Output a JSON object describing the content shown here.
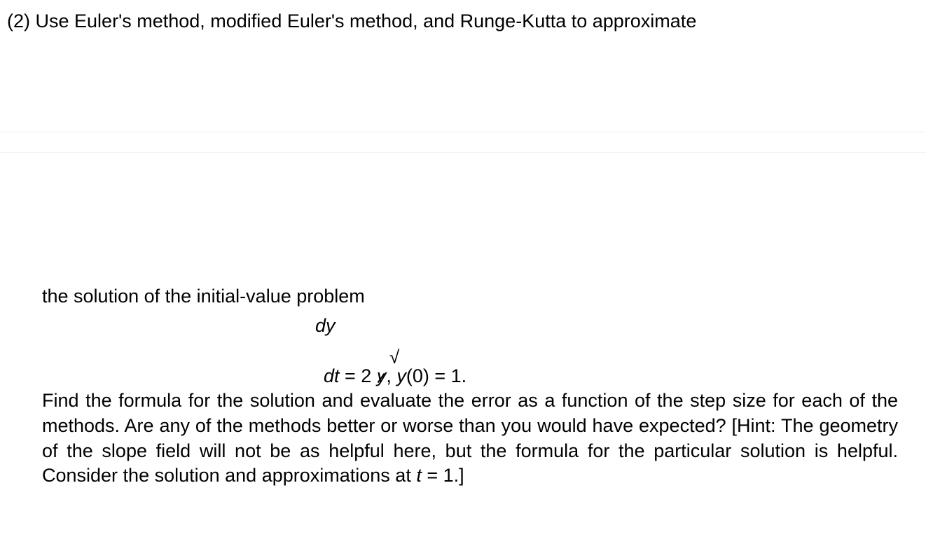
{
  "problem": {
    "number": "(2)",
    "prompt": "Use Euler's method, modified Euler's method, and Runge-Kutta to approximate",
    "intro": "the solution of the initial-value problem",
    "equation": {
      "dy": "dy",
      "dt": "dt",
      "eq": " = 2 ",
      "sqrt": "√",
      "y_var": "y",
      "comma": ", ",
      "y_of": "y",
      "paren_open": "(0) = 1.",
      "full_rhs_after_y": ", y(0) = 1."
    },
    "body_part1": "Find the formula for the solution and evaluate the error as a function of the step size for each of the methods. Are any of the methods better or worse than you would have expected? [Hint: The geometry of the slope field will not be as helpful here, but the formula for the particular solution is helpful. Consider the solution and approximations at ",
    "body_t": "t",
    "body_part2": " = 1.]"
  }
}
